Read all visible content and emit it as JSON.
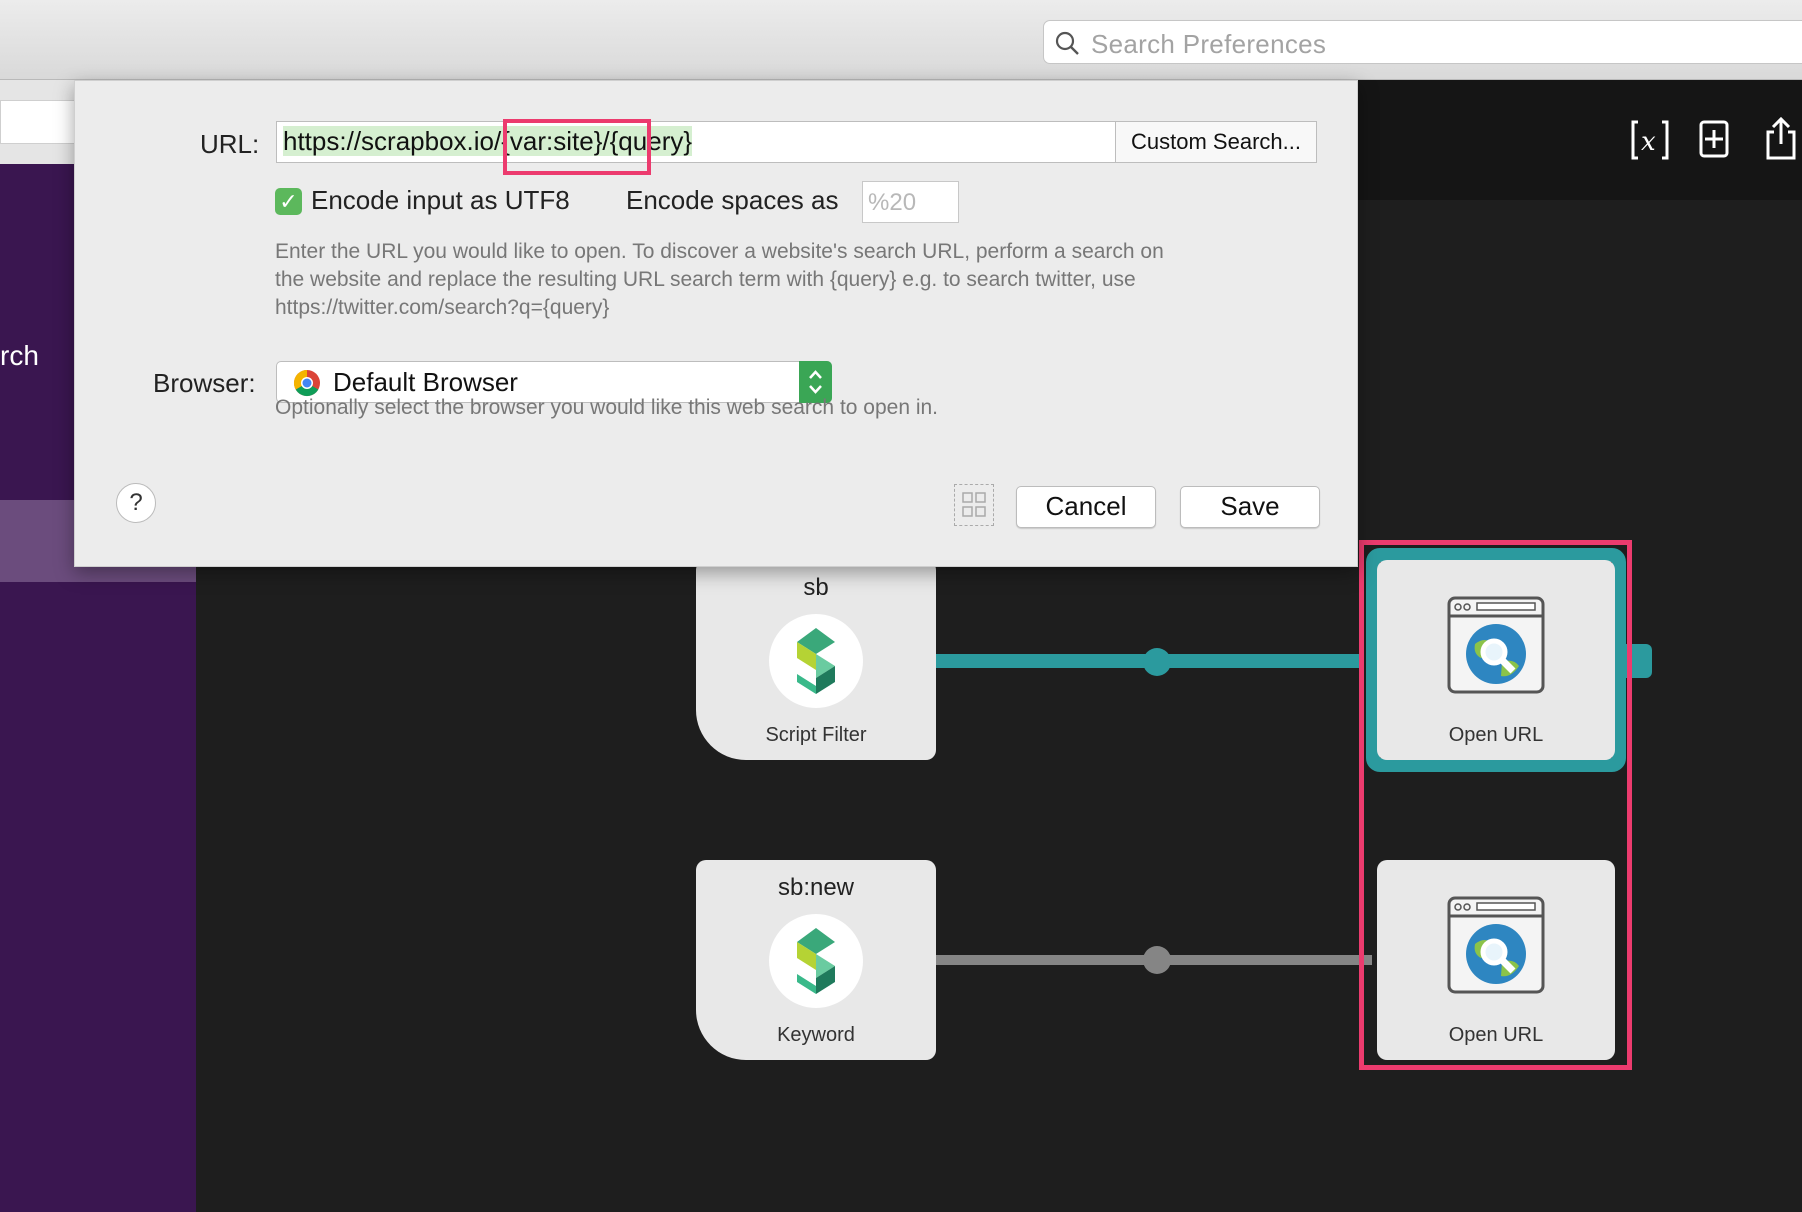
{
  "toolbar": {
    "search_placeholder": "Search Preferences"
  },
  "sidebar": {
    "partial_label": "rch"
  },
  "dialog": {
    "url_label": "URL:",
    "url_value_prefix": "https://scrapbox.io",
    "url_value_var": "/{var:site}/",
    "url_value_suffix": "{query}",
    "custom_search_label": "Custom Search...",
    "encode_utf8_label": "Encode input as UTF8",
    "encode_utf8_checked": true,
    "encode_spaces_label": "Encode spaces as",
    "encode_spaces_placeholder": "%20",
    "help_text_line1": "Enter the URL you would like to open. To discover a website's search URL, perform a search on",
    "help_text_line2": "the website and replace the resulting URL search term with {query} e.g. to search twitter, use",
    "help_text_line3": "https://twitter.com/search?q={query}",
    "browser_label": "Browser:",
    "browser_value": "Default Browser",
    "browser_help": "Optionally select the browser you would like this web search to open in.",
    "help_button": "?",
    "cancel_label": "Cancel",
    "save_label": "Save"
  },
  "nodes": {
    "script_filter": {
      "title": "sb",
      "subtitle": "Script Filter"
    },
    "keyword": {
      "title": "sb:new",
      "subtitle": "Keyword"
    },
    "open_url_1": {
      "subtitle": "Open URL"
    },
    "open_url_2": {
      "subtitle": "Open URL"
    }
  },
  "colors": {
    "accent_teal": "#2b9a9e",
    "highlight_pink": "#ec3b6e",
    "sidebar_purple": "#3a1650"
  },
  "icons": [
    "search-icon",
    "variable-icon",
    "add-icon",
    "share-icon",
    "scrapbox-logo-icon",
    "browser-globe-icon",
    "chrome-icon",
    "grid-icon"
  ]
}
